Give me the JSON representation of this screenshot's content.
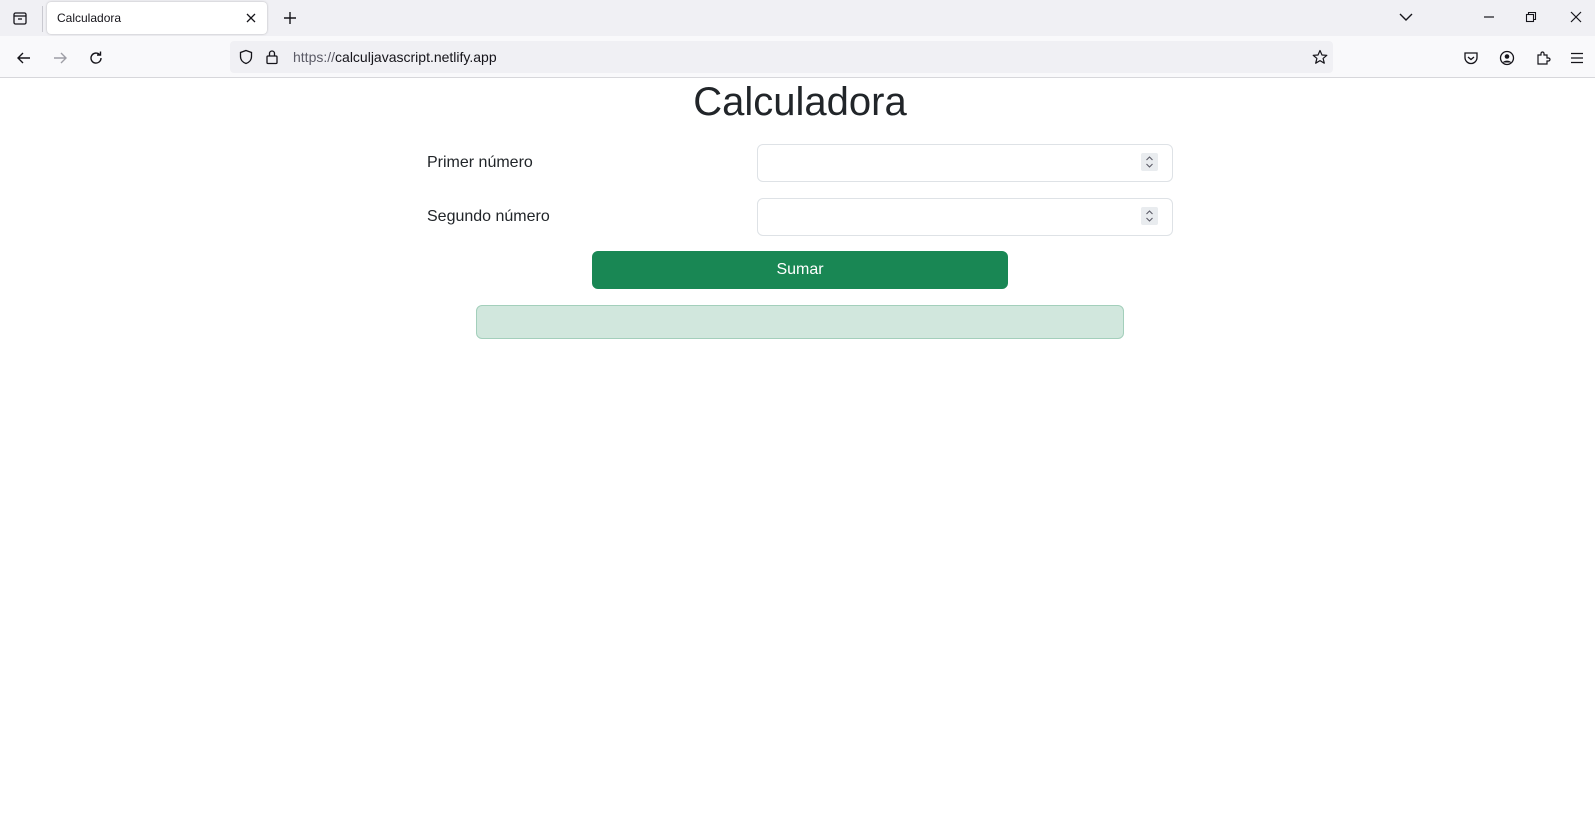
{
  "browser": {
    "tab_title": "Calculadora",
    "url_scheme": "https://",
    "url_host": "calculjavascript.netlify.app"
  },
  "page": {
    "title": "Calculadora",
    "first_label": "Primer número",
    "first_value": "",
    "second_label": "Segundo número",
    "second_value": "",
    "button_label": "Sumar",
    "result_text": ""
  },
  "colors": {
    "button": "#198754",
    "result_bg": "#d1e7dd"
  }
}
